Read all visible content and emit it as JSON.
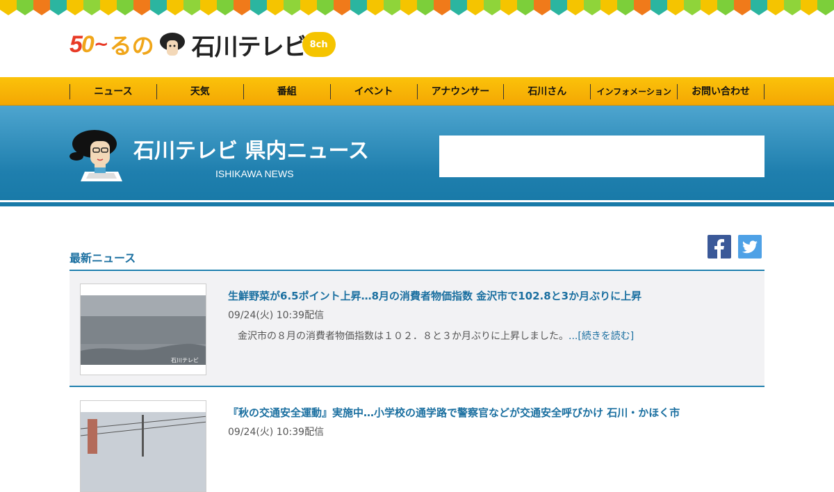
{
  "header": {
    "logo": {
      "fifty_a": "5",
      "fifty_b": "0",
      "tilde": "~",
      "runo": "るの",
      "brand": "石川テレビ",
      "channel": "8ch"
    }
  },
  "nav": {
    "items": [
      "ニュース",
      "天気",
      "番組",
      "イベント",
      "アナウンサー",
      "石川さん",
      "インフォメーション",
      "お問い合わせ"
    ]
  },
  "banner": {
    "title": "石川テレビ 県内ニュース",
    "subtitle": "ISHIKAWA NEWS"
  },
  "social": {
    "facebook_icon": "facebook-icon",
    "twitter_icon": "twitter-icon"
  },
  "news": {
    "section_title": "最新ニュース",
    "items": [
      {
        "title": "生鮮野菜が6.5ポイント上昇…8月の消費者物価指数 金沢市で102.8と3か月ぶりに上昇",
        "date": "09/24(火) 10:39配信",
        "desc": "金沢市の８月の消費者物価指数は１０２．８と３か月ぶりに上昇しました。",
        "more": "...[続きを読む]",
        "thumb_label": "石川テレビ"
      },
      {
        "title": "『秋の交通安全運動』実施中…小学校の通学路で警察官などが交通安全呼びかけ 石川・かほく市",
        "date": "09/24(火) 10:39配信"
      }
    ]
  },
  "colors": {
    "accent": "#1a6fa0",
    "nav_bg": "#fbc20a",
    "banner_bg": "#2a8cbb"
  }
}
